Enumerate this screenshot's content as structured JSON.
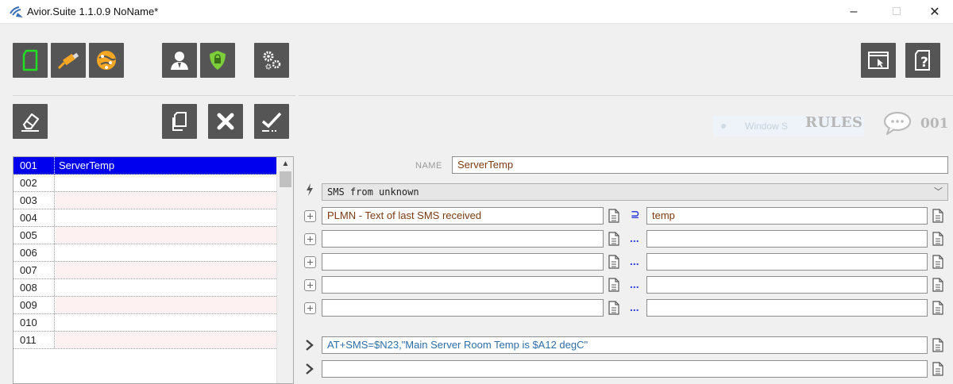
{
  "window": {
    "title": "Avior.Suite 1.1.0.9  NoName*",
    "minimize": "–",
    "maximize": "□",
    "close": "✕"
  },
  "toolbar": {
    "main_buttons": [
      "new-file-icon",
      "usb-connection-icon",
      "globe-network-icon",
      "user-icon",
      "security-shield-icon",
      "settings-gears-icon"
    ],
    "right_buttons": [
      "window-cursor-icon",
      "help-file-icon"
    ],
    "list_buttons": [
      "eraser-icon",
      "copy-icon",
      "delete-x-icon",
      "apply-check-icon"
    ],
    "colors": {
      "button_bg": "#555555",
      "accent_green": "#22dd22",
      "accent_orange": "#f5a623",
      "selected_row": "#0000ee"
    }
  },
  "rules_header": {
    "faded_label": "Window S",
    "title": "RULES",
    "number": "001"
  },
  "rules_list": {
    "items": [
      {
        "num": "001",
        "label": "ServerTemp"
      },
      {
        "num": "002",
        "label": ""
      },
      {
        "num": "003",
        "label": ""
      },
      {
        "num": "004",
        "label": ""
      },
      {
        "num": "005",
        "label": ""
      },
      {
        "num": "006",
        "label": ""
      },
      {
        "num": "007",
        "label": ""
      },
      {
        "num": "008",
        "label": ""
      },
      {
        "num": "009",
        "label": ""
      },
      {
        "num": "010",
        "label": ""
      },
      {
        "num": "011",
        "label": ""
      }
    ],
    "selected_index": 0
  },
  "form": {
    "name_label": "NAME",
    "name_value": "ServerTemp",
    "trigger_value": "SMS from unknown",
    "conditions": [
      {
        "left": "PLMN - Text of last SMS received",
        "operator": "⊇",
        "right": "temp"
      },
      {
        "left": "",
        "operator": "...",
        "right": ""
      },
      {
        "left": "",
        "operator": "...",
        "right": ""
      },
      {
        "left": "",
        "operator": "...",
        "right": ""
      },
      {
        "left": "",
        "operator": "...",
        "right": ""
      }
    ],
    "actions": [
      "AT+SMS=$N23,\"Main Server Room Temp is $A12 degC\"",
      ""
    ]
  }
}
